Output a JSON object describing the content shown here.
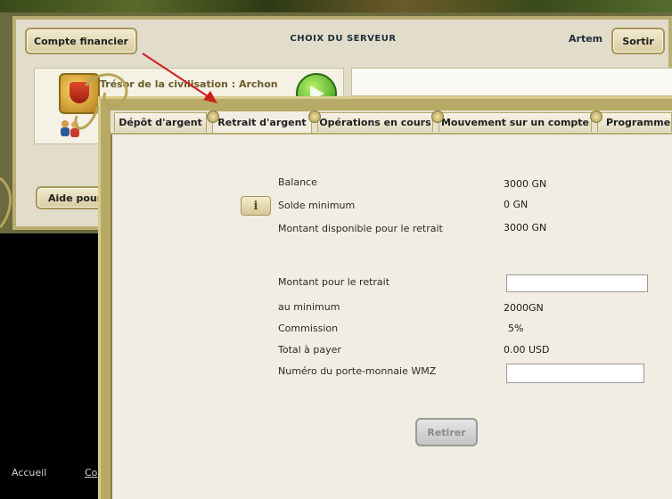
{
  "header": {
    "account_button": "Compte financier",
    "server_title": "CHOIX DU SERVEUR",
    "user": "Artem",
    "logout_button": "Sortir"
  },
  "civilization": {
    "text": "Trésor de la civilisation : Archon"
  },
  "left_panel": {
    "help_button": "Aide pour"
  },
  "footer": {
    "home": "Accueil",
    "second": "Co"
  },
  "tabs": [
    {
      "label": "Dépôt d'argent",
      "active": false
    },
    {
      "label": "Retrait d'argent",
      "active": true
    },
    {
      "label": "Opérations en cours",
      "active": false
    },
    {
      "label": "Mouvement sur un compte",
      "active": false
    },
    {
      "label": "Programme p",
      "active": false
    }
  ],
  "balance": {
    "balance_label": "Balance",
    "balance_value": "3000 GN",
    "min_label": "Solde minimum",
    "min_value": "0 GN",
    "available_label": "Montant disponible pour le retrait",
    "available_value": "3000 GN"
  },
  "withdraw": {
    "amount_label": "Montant pour le retrait",
    "amount_value": "",
    "minimum_label": "au minimum",
    "minimum_value": "2000GN",
    "commission_label": "Commission",
    "commission_value": "5%",
    "total_label": "Total à payer",
    "total_value": "0.00 USD",
    "wallet_label": "Numéro du porte-monnaie WMZ",
    "wallet_value": "",
    "submit_button": "Retirer"
  },
  "icons": {
    "info": "info-icon",
    "shield": "shield-icon",
    "play": "play-icon",
    "people": "people-icon"
  },
  "colors": {
    "frame_gold": "#b6aa66",
    "panel_bg": "#f1ede2",
    "arrow": "#cc1f1f"
  }
}
